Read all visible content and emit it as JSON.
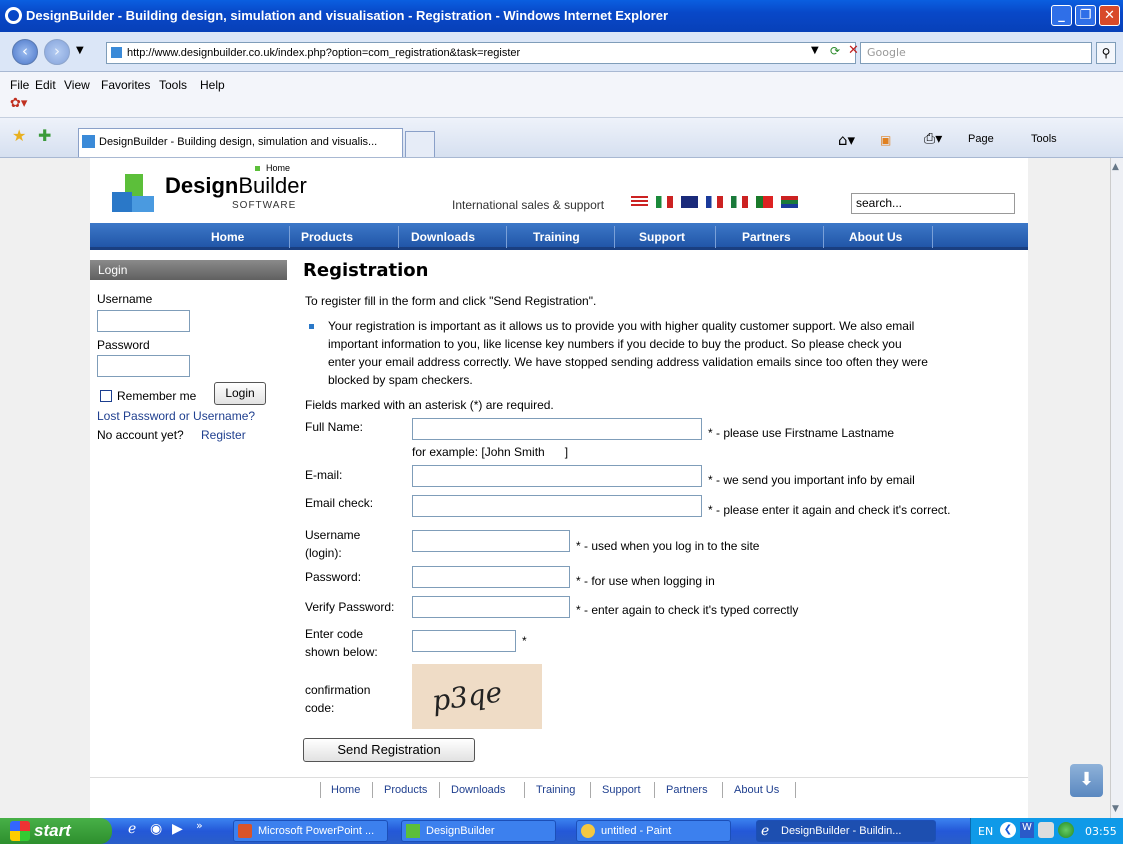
{
  "window": {
    "title": "DesignBuilder - Building design, simulation and visualisation - Registration - Windows Internet Explorer"
  },
  "address": {
    "url": "http://www.designbuilder.co.uk/index.php?option=com_registration&task=register",
    "search_placeholder": "Google"
  },
  "menu": [
    "File",
    "Edit",
    "View",
    "Favorites",
    "Tools",
    "Help"
  ],
  "tab": {
    "label": "DesignBuilder - Building design, simulation and visualis..."
  },
  "command_bar": {
    "page": "Page",
    "tools": "Tools"
  },
  "site": {
    "brand_bold": "Design",
    "brand_light": "Builder",
    "brand_sub": "SOFTWARE",
    "crumb": "Home",
    "intl": "International sales & support",
    "search_value": "search..."
  },
  "nav": [
    "Home",
    "Products",
    "Downloads",
    "Training",
    "Support",
    "Partners",
    "About Us"
  ],
  "login": {
    "header": "Login",
    "username_label": "Username",
    "password_label": "Password",
    "remember": "Remember me",
    "button": "Login",
    "lost": "Lost Password or Username?",
    "no_account": "No account yet?",
    "register": "Register"
  },
  "form": {
    "title": "Registration",
    "intro": "To register fill in the form and click \"Send Registration\".",
    "bullet_lines": [
      "Your registration is important as it allows us to provide you with higher quality customer support. We also email",
      "important information to you, like license key numbers if you decide to buy the product. So please check you",
      "enter your email address correctly. We have stopped sending address validation emails since too often they were",
      "blocked by spam checkers."
    ],
    "required_note": "Fields marked with an asterisk (*) are required.",
    "fullname_label": "Full Name:",
    "fullname_hint": "* - please use Firstname Lastname",
    "fullname_example": "for example: [John Smith      ]",
    "email_label": "E-mail:",
    "email_hint": "* - we send you important info by email",
    "emailcheck_label": "Email check:",
    "emailcheck_hint": "* - please enter it again and check it's correct.",
    "username_label_1": "Username",
    "username_label_2": "(login):",
    "username_hint": "* - used when you log in to the site",
    "password_label": "Password:",
    "password_hint": "* - for use when logging in",
    "verify_label": "Verify Password:",
    "verify_hint": "* - enter again to check it's typed correctly",
    "code_label_1": "Enter code",
    "code_label_2": "shown below:",
    "code_hint": "*",
    "confirm_label_1": "confirmation",
    "confirm_label_2": "code:",
    "captcha_text": "p3qe",
    "submit": "Send Registration"
  },
  "footer": [
    "Home",
    "Products",
    "Downloads",
    "Training",
    "Support",
    "Partners",
    "About Us"
  ],
  "taskbar": {
    "start": "start",
    "tasks": [
      "Microsoft PowerPoint ...",
      "DesignBuilder",
      "untitled - Paint",
      "DesignBuilder - Buildin..."
    ],
    "lang": "EN",
    "clock": "03:55"
  }
}
